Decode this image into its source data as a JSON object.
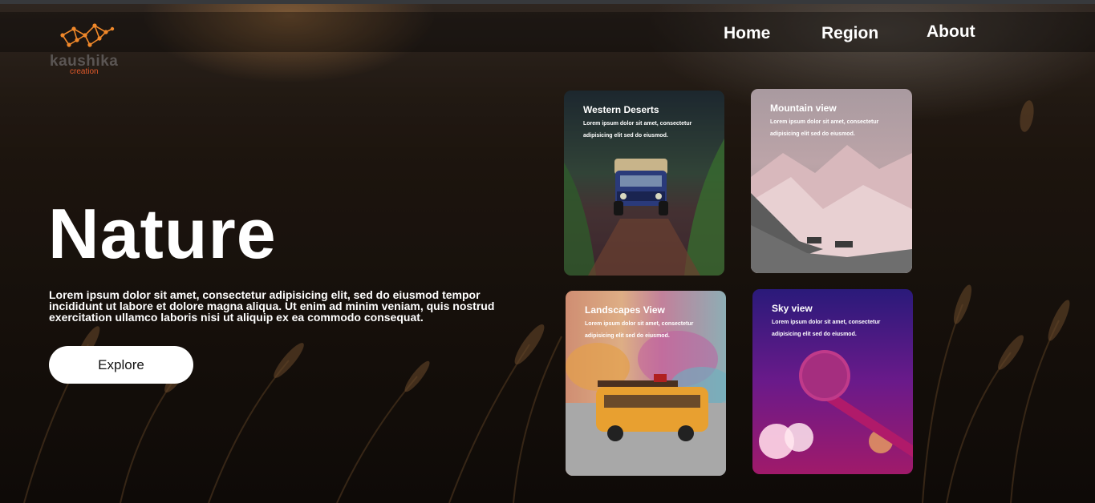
{
  "brand": {
    "name": "kaushika",
    "tagline": "creation",
    "accent": "#f0882a"
  },
  "nav": {
    "items": [
      {
        "label": "Home"
      },
      {
        "label": "Region"
      },
      {
        "label": "About"
      }
    ]
  },
  "hero": {
    "title": "Nature",
    "description": "Lorem ipsum dolor sit amet, consectetur adipisicing elit, sed do eiusmod tempor incididunt ut labore et dolore magna aliqua. Ut enim ad minim veniam, quis nostrud exercitation ullamco laboris nisi ut aliquip ex ea commodo consequat.",
    "button_label": "Explore"
  },
  "cards": [
    {
      "title": "Western Deserts",
      "text": "Lorem ipsum dolor sit amet, consectetur adipisicing elit sed do eiusmod."
    },
    {
      "title": "Mountain view",
      "text": "Lorem ipsum dolor sit amet, consectetur adipisicing elit sed do eiusmod."
    },
    {
      "title": "Landscapes View",
      "text": "Lorem ipsum dolor sit amet, consectetur adipisicing elit sed do eiusmod."
    },
    {
      "title": "Sky view",
      "text": "Lorem ipsum dolor sit amet, consectetur adipisicing elit sed do eiusmod."
    }
  ]
}
